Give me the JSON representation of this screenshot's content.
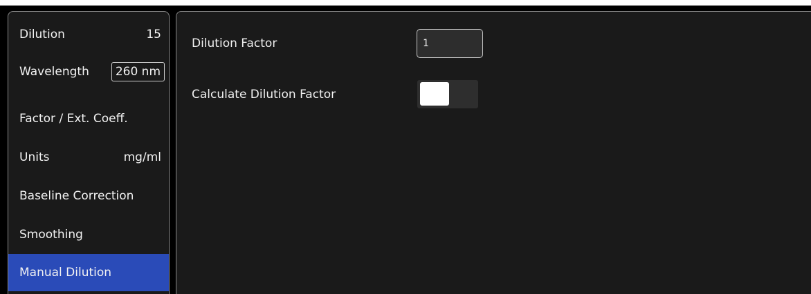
{
  "sidebar": {
    "items": [
      {
        "label": "Dilution",
        "value": "15"
      },
      {
        "label": "Wavelength",
        "value": "260 nm"
      },
      {
        "label": "Factor / Ext. Coeff.",
        "value": ""
      },
      {
        "label": "Units",
        "value": "mg/ml"
      },
      {
        "label": "Baseline Correction",
        "value": ""
      },
      {
        "label": "Smoothing",
        "value": ""
      },
      {
        "label": "Manual Dilution",
        "value": ""
      }
    ],
    "selected_index": 6
  },
  "main": {
    "dilution_factor_label": "Dilution Factor",
    "dilution_factor_value": "1",
    "calculate_label": "Calculate Dilution Factor",
    "calculate_enabled": false
  },
  "colors": {
    "accent": "#2a4bb8",
    "panel": "#1a1a1a",
    "background": "#000000"
  }
}
